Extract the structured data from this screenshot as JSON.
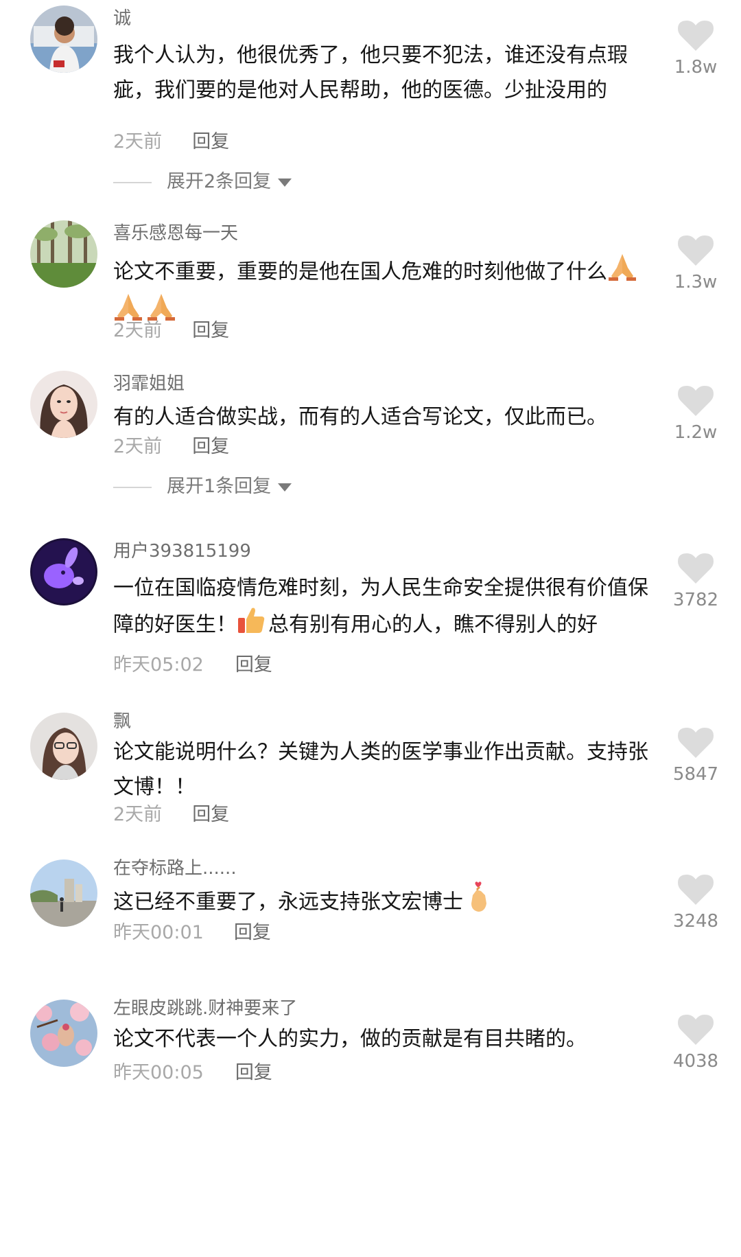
{
  "comments": [
    {
      "username": "诚",
      "text": "我个人认为，他很优秀了，他只要不犯法，谁还没有点瑕疵，我们要的是他对人民帮助，他的医德。少扯没用的",
      "time": "2天前",
      "reply_label": "回复",
      "likes": "1.8w",
      "expand": "展开2条回复",
      "avatar_icon": "woman-photo-avatar"
    },
    {
      "username": "喜乐感恩每一天",
      "text": "论文不重要，重要的是他在国人危难的时刻他做了什么",
      "emojis": [
        "praying-hands-icon",
        "praying-hands-icon",
        "praying-hands-icon"
      ],
      "time": "2天前",
      "reply_label": "回复",
      "likes": "1.3w",
      "avatar_icon": "forest-photo-avatar"
    },
    {
      "username": "羽霏姐姐",
      "text": "有的人适合做实战，而有的人适合写论文，仅此而已。",
      "time": "2天前",
      "reply_label": "回复",
      "likes": "1.2w",
      "expand": "展开1条回复",
      "avatar_icon": "woman-portrait-avatar"
    },
    {
      "username": "用户393815199",
      "text_before": "一位在国临疫情危难时刻，为人民生命安全提供很有价值保障的好医生！",
      "emojis": [
        "thumbs-up-icon"
      ],
      "text_after": "总有别有用心的人，瞧不得别人的好",
      "time": "昨天05:02",
      "reply_label": "回复",
      "likes": "3782",
      "avatar_icon": "purple-rabbit-avatar"
    },
    {
      "username": "飘",
      "text": "论文能说明什么？关键为人类的医学事业作出贡献。支持张文博！！",
      "time": "2天前",
      "reply_label": "回复",
      "likes": "5847",
      "avatar_icon": "woman-glasses-avatar"
    },
    {
      "username": "在夺标路上......",
      "text": "这已经不重要了，永远支持张文宏博士",
      "emojis": [
        "finger-heart-icon"
      ],
      "time": "昨天00:01",
      "reply_label": "回复",
      "likes": "3248",
      "avatar_icon": "street-photo-avatar"
    },
    {
      "username": "左眼皮跳跳.财神要来了",
      "text": "论文不代表一个人的实力，做的贡献是有目共睹的。",
      "time": "昨天00:05",
      "reply_label": "回复",
      "likes": "4038",
      "avatar_icon": "pink-flowers-avatar"
    }
  ],
  "colors": {
    "username": "#6e6e6e",
    "text": "#161616",
    "meta": "#a8a8a8",
    "like_icon": "#dcdcdc"
  }
}
